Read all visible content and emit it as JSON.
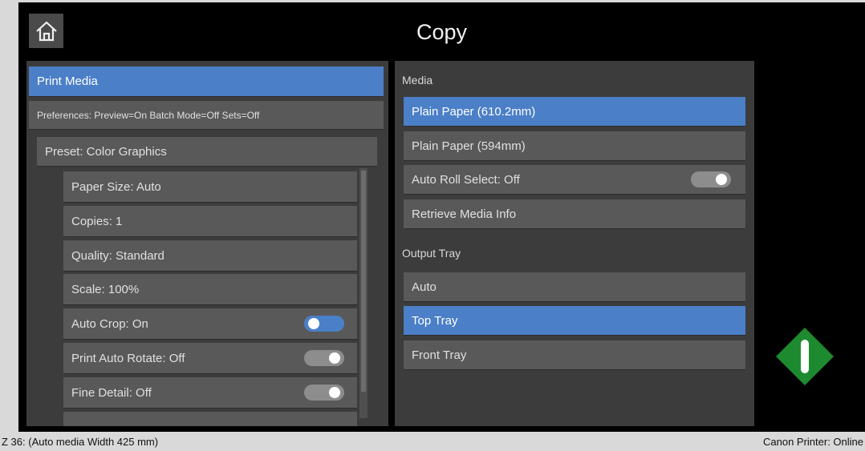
{
  "header": {
    "title": "Copy"
  },
  "left_panel": {
    "print_media": "Print Media",
    "preferences": "Preferences: Preview=On Batch Mode=Off Sets=Off",
    "preset": "Preset: Color Graphics",
    "settings": [
      {
        "label": "Paper Size: Auto"
      },
      {
        "label": "Copies: 1"
      },
      {
        "label": "Quality: Standard"
      },
      {
        "label": "Scale: 100%"
      },
      {
        "label": "Auto Crop: On",
        "toggle": "on"
      },
      {
        "label": "Print Auto Rotate: Off",
        "toggle": "off"
      },
      {
        "label": "Fine Detail: Off",
        "toggle": "off"
      }
    ]
  },
  "right_panel": {
    "media_label": "Media",
    "media_items": [
      {
        "label": "Plain Paper (610.2mm)",
        "selected": true
      },
      {
        "label": "Plain Paper (594mm)",
        "selected": false
      }
    ],
    "auto_roll_select": "Auto Roll Select: Off",
    "retrieve_media_info": "Retrieve Media Info",
    "output_tray_label": "Output Tray",
    "tray_items": [
      {
        "label": "Auto",
        "selected": false
      },
      {
        "label": "Top Tray",
        "selected": true
      },
      {
        "label": "Front Tray",
        "selected": false
      }
    ]
  },
  "status": {
    "left": "Z 36: (Auto media Width 425 mm)",
    "right": "Canon Printer: Online"
  },
  "colors": {
    "accent": "#4b7fc7",
    "start_button": "#1e8a2f"
  }
}
